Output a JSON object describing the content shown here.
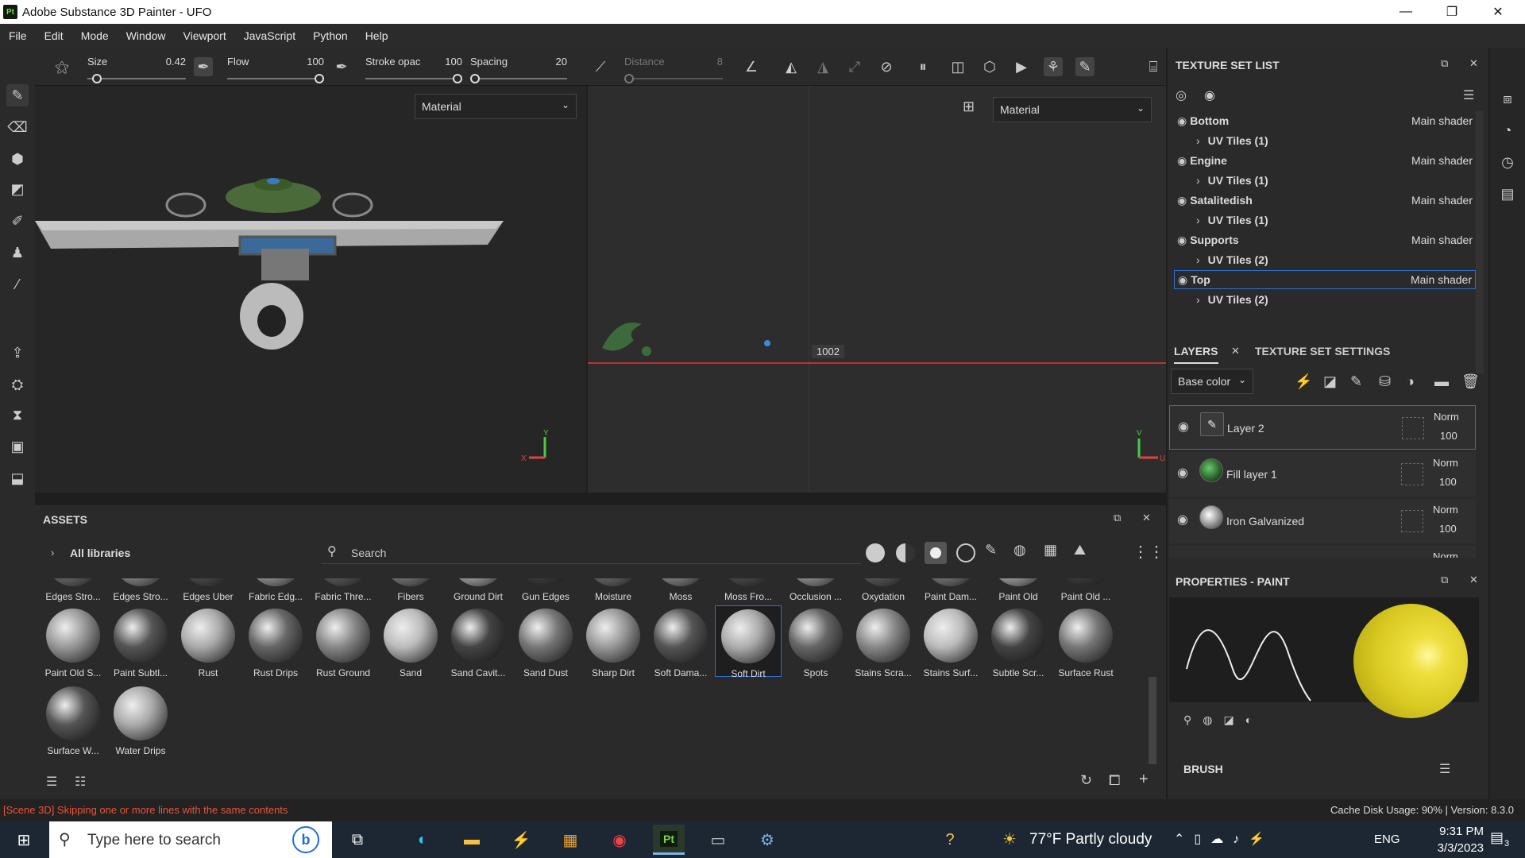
{
  "window": {
    "title": "Adobe Substance 3D Painter - UFO",
    "app_badge": "Pt",
    "min": "—",
    "max": "❐",
    "close": "✕"
  },
  "menu": [
    "File",
    "Edit",
    "Mode",
    "Window",
    "Viewport",
    "JavaScript",
    "Python",
    "Help"
  ],
  "toolbar": {
    "size": {
      "label": "Size",
      "value": "0.42",
      "level": 0.05
    },
    "flow": {
      "label": "Flow",
      "value": "100",
      "level": 1.0
    },
    "stroke": {
      "label": "Stroke opac",
      "value": "100",
      "level": 1.0
    },
    "spacing": {
      "label": "Spacing",
      "value": "20",
      "level": 0.0
    },
    "distance": {
      "label": "Distance",
      "value": "8",
      "level": 0.0
    }
  },
  "viewport3d": {
    "dropdown": "Material",
    "axis_y": "Y",
    "axis_x": "X"
  },
  "viewport2d": {
    "dropdown": "Material",
    "tile_label": "1002",
    "axis_v": "V",
    "axis_u": "U"
  },
  "assets": {
    "title": "ASSETS",
    "library": "All libraries",
    "search_placeholder": "Search",
    "row1": [
      "Edges Stro...",
      "Edges Stro...",
      "Edges Uber",
      "Fabric Edg...",
      "Fabric Thre...",
      "Fibers",
      "Ground Dirt",
      "Gun Edges",
      "Moisture",
      "Moss",
      "Moss Fro...",
      "Occlusion ...",
      "Oxydation",
      "Paint Dam...",
      "Paint Old",
      "Paint Old ..."
    ],
    "row2": [
      "Paint Old S...",
      "Paint Subtl...",
      "Rust",
      "Rust Drips",
      "Rust Ground",
      "Sand",
      "Sand Cavit...",
      "Sand Dust",
      "Sharp Dirt",
      "Soft Dama...",
      "Soft Dirt",
      "Spots",
      "Stains Scra...",
      "Stains Surf...",
      "Subtle Scr...",
      "Surface Rust"
    ],
    "row3": [
      "Surface W...",
      "Water Drips"
    ],
    "selected": "Soft Dirt"
  },
  "texture_set_list": {
    "title": "TEXTURE SET LIST",
    "sets": [
      {
        "name": "Bottom",
        "shader": "Main shader",
        "uv": "UV Tiles (1)"
      },
      {
        "name": "Engine",
        "shader": "Main shader",
        "uv": "UV Tiles (1)"
      },
      {
        "name": "Satalitedish",
        "shader": "Main shader",
        "uv": "UV Tiles (1)"
      },
      {
        "name": "Supports",
        "shader": "Main shader",
        "uv": "UV Tiles (2)"
      },
      {
        "name": "Top",
        "shader": "Main shader",
        "uv": "UV Tiles (2)"
      }
    ],
    "selected": "Top"
  },
  "layers": {
    "tab_layers": "LAYERS",
    "tab_settings": "TEXTURE SET SETTINGS",
    "channel": "Base color",
    "items": [
      {
        "name": "Layer 2",
        "blend": "Norm",
        "opacity": "100"
      },
      {
        "name": "Fill layer 1",
        "blend": "Norm",
        "opacity": "100"
      },
      {
        "name": "Iron Galvanized",
        "blend": "Norm",
        "opacity": "100"
      }
    ],
    "partial_blend": "Norm"
  },
  "properties": {
    "title": "PROPERTIES - PAINT",
    "brush": "BRUSH"
  },
  "status": {
    "message": "[Scene 3D] Skipping one or more lines with the same contents",
    "cache": "Cache Disk Usage:  90% | Version: 8.3.0"
  },
  "taskbar": {
    "search": "Type here to search",
    "weather": "77°F  Partly cloudy",
    "lang": "ENG",
    "time": "9:31 PM",
    "date": "3/3/2023",
    "notif": "3"
  },
  "colors": {
    "accent": "#2f6fcf",
    "error": "#e8543a",
    "brand": "#7cd34a"
  }
}
